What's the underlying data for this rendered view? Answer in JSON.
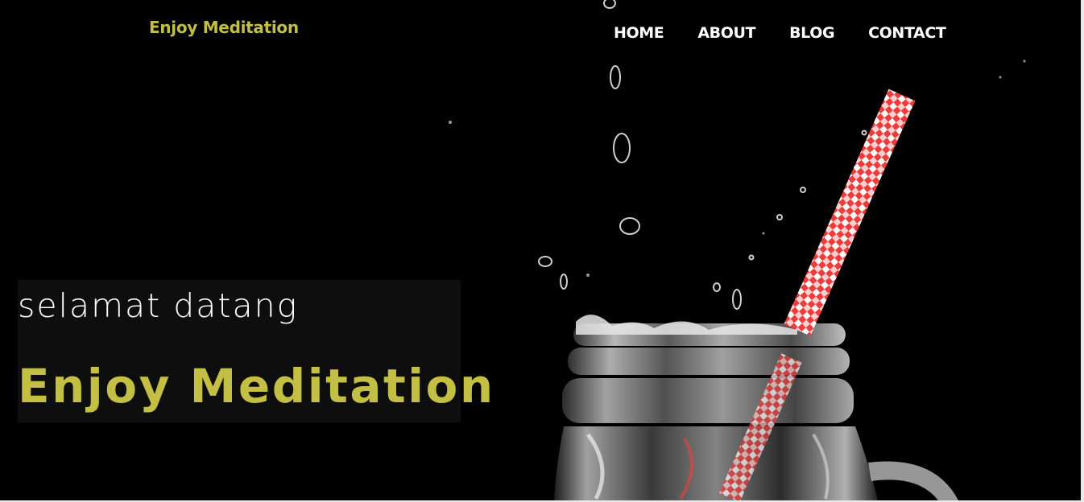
{
  "header": {
    "brand": "Enjoy Meditation",
    "nav": [
      "HOME",
      "ABOUT",
      "BLOG",
      "CONTACT"
    ]
  },
  "hero": {
    "subtitle": "selamat datang",
    "title": "Enjoy Meditation",
    "image": "jar-of-water-with-red-straw"
  },
  "colors": {
    "background": "#000000",
    "accent": "#c3bf45",
    "nav_text": "#ffffff",
    "box": "#0e0e0e"
  }
}
